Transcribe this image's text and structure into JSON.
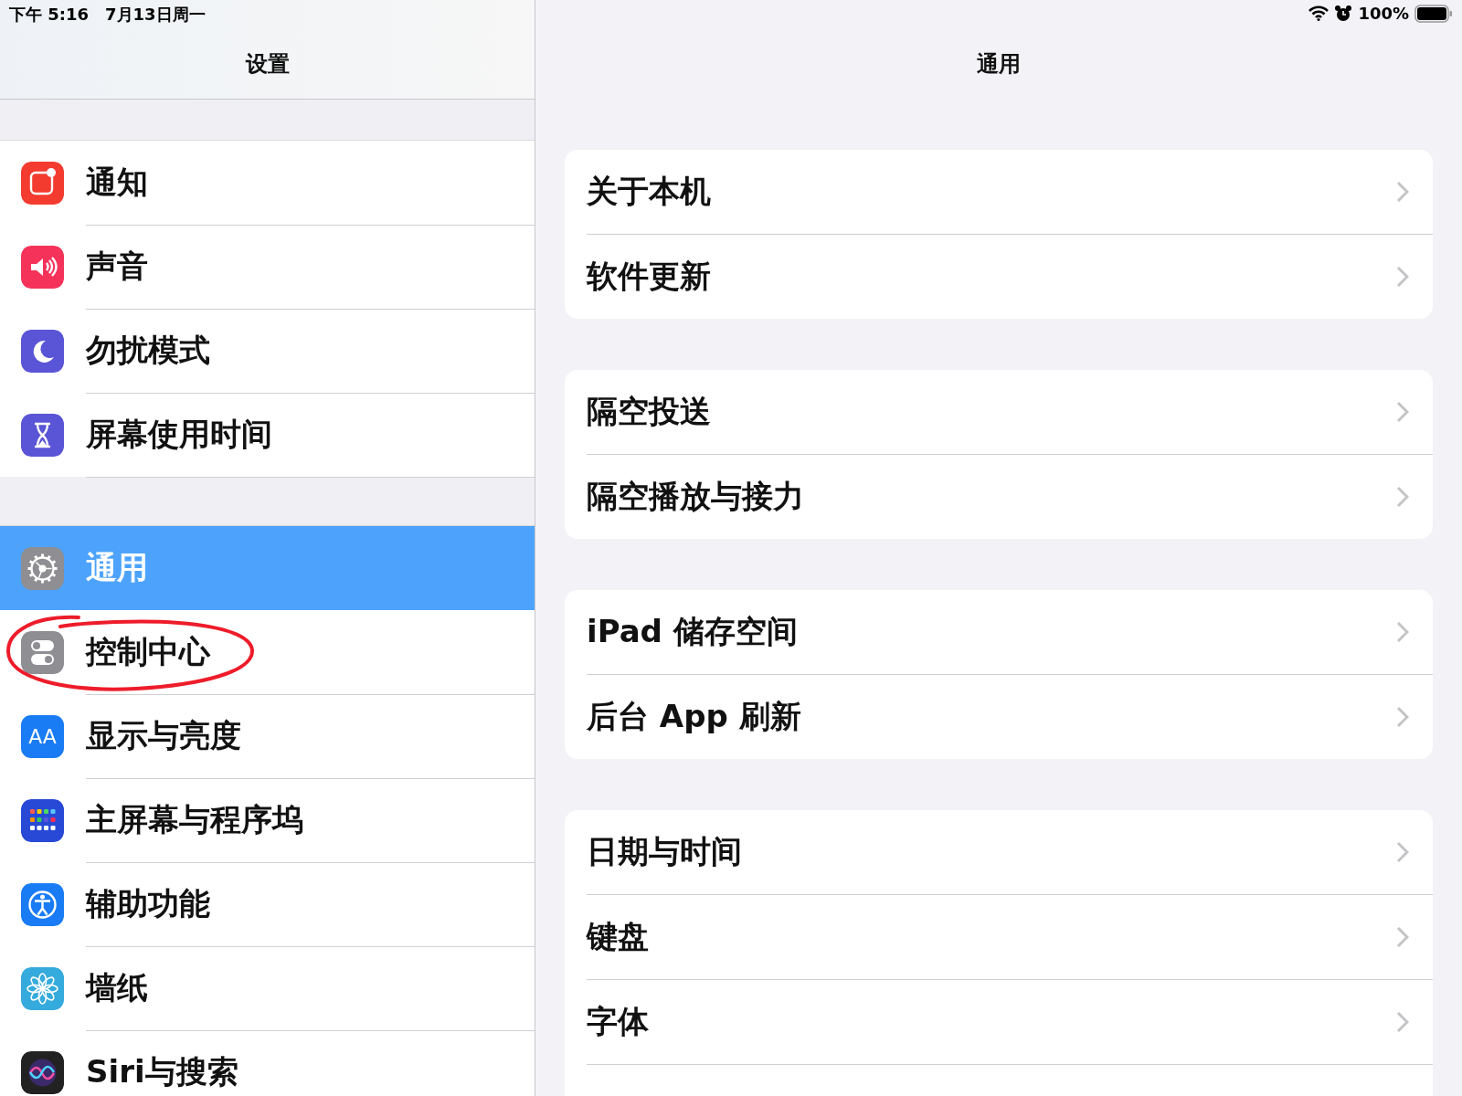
{
  "status_bar": {
    "time": "下午 5:16",
    "date": "7月13日周一",
    "battery": "100%"
  },
  "sidebar": {
    "title": "设置",
    "groups": [
      [
        {
          "label": "通知",
          "kind": "notifications",
          "selected": false,
          "circled": false
        },
        {
          "label": "声音",
          "kind": "sounds",
          "selected": false,
          "circled": false
        },
        {
          "label": "勿扰模式",
          "kind": "moon",
          "selected": false,
          "circled": false
        },
        {
          "label": "屏幕使用时间",
          "kind": "hourglass",
          "selected": false,
          "circled": false
        }
      ],
      [
        {
          "label": "通用",
          "kind": "gear",
          "selected": true,
          "circled": false
        },
        {
          "label": "控制中心",
          "kind": "toggles",
          "selected": false,
          "circled": true
        },
        {
          "label": "显示与亮度",
          "kind": "textsize",
          "icon_text": "AA",
          "selected": false,
          "circled": false
        },
        {
          "label": "主屏幕与程序坞",
          "kind": "grid",
          "selected": false,
          "circled": false
        },
        {
          "label": "辅助功能",
          "kind": "accessibility",
          "selected": false,
          "circled": false
        },
        {
          "label": "墙纸",
          "kind": "flower",
          "selected": false,
          "circled": false
        },
        {
          "label": "Siri与搜索",
          "kind": "siri",
          "selected": false,
          "circled": false
        }
      ]
    ]
  },
  "detail": {
    "title": "通用",
    "groups": [
      [
        "关于本机",
        "软件更新"
      ],
      [
        "隔空投送",
        "隔空播放与接力"
      ],
      [
        "iPad 储存空间",
        "后台 App 刷新"
      ],
      [
        "日期与时间",
        "键盘",
        "字体"
      ]
    ]
  }
}
